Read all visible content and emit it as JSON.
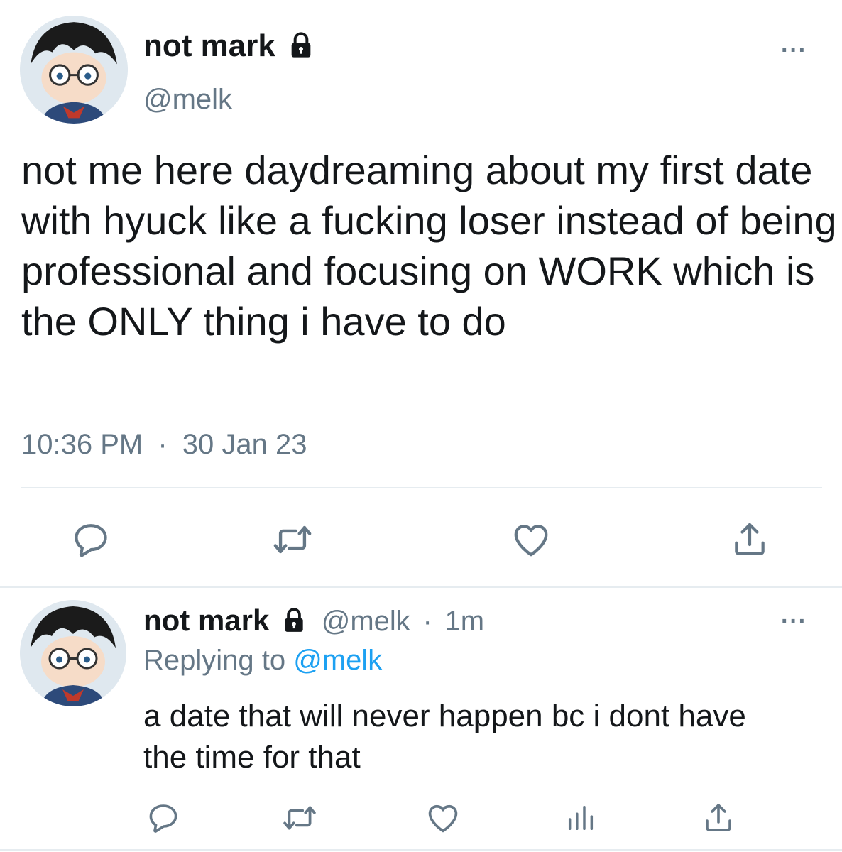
{
  "main_tweet": {
    "display_name": "not mark",
    "handle": "@melk",
    "text": "not me here daydreaming about my first date with hyuck like a fucking loser instead of being professional and focusing on WORK which is the ONLY thing i have to do",
    "time": "10:36 PM",
    "separator": "·",
    "date": "30 Jan 23",
    "more_label": "···"
  },
  "reply_tweet": {
    "display_name": "not mark",
    "handle": "@melk",
    "separator": "·",
    "age": "1m",
    "replying_prefix": "Replying to",
    "replying_to": "@melk",
    "text": "a date that will never happen bc i dont have the time for that",
    "more_label": "···"
  },
  "icons": {
    "reply": "speech-bubble-icon",
    "retweet": "retweet-icon",
    "like": "heart-icon",
    "share": "share-icon",
    "analytics": "bar-chart-icon",
    "lock": "lock-icon",
    "more": "ellipsis-icon"
  },
  "colors": {
    "text": "#14171a",
    "muted": "#657786",
    "link": "#1da1f2",
    "divider": "#e6ecf0"
  }
}
